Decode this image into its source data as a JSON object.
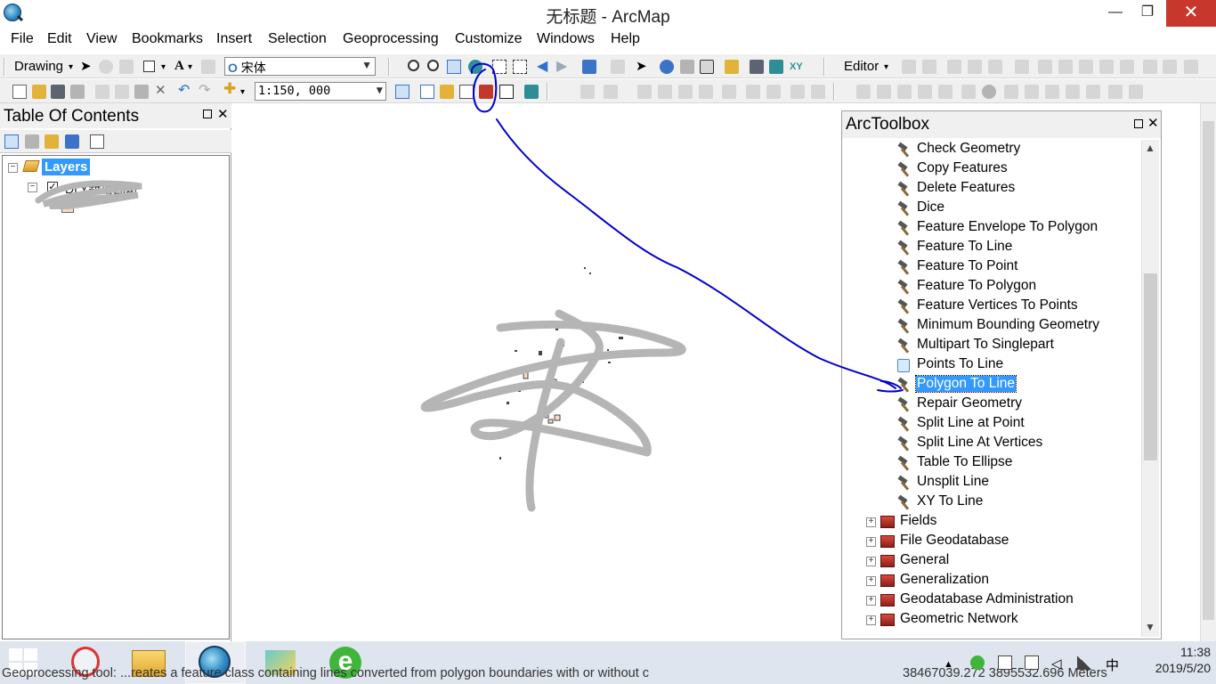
{
  "window": {
    "title": "无标题 - ArcMap",
    "minimize": "—",
    "maximize": "❐",
    "close": "✕"
  },
  "menu": [
    "File",
    "Edit",
    "View",
    "Bookmarks",
    "Insert",
    "Selection",
    "Geoprocessing",
    "Customize",
    "Windows",
    "Help"
  ],
  "toolbar1": {
    "drawing_label": "Drawing",
    "font_name": "宋体",
    "editor_label": "Editor"
  },
  "toolbar2": {
    "scale": "1:150, 000"
  },
  "toc": {
    "title": "Table Of Contents",
    "layers_label": "Layers",
    "layer_name": "DLY新增图斑",
    "checked": true
  },
  "toolbox": {
    "title": "ArcToolbox",
    "tools": [
      {
        "label": "Check Geometry",
        "kind": "hammer"
      },
      {
        "label": "Copy Features",
        "kind": "hammer"
      },
      {
        "label": "Delete Features",
        "kind": "hammer"
      },
      {
        "label": "Dice",
        "kind": "hammer"
      },
      {
        "label": "Feature Envelope To Polygon",
        "kind": "hammer"
      },
      {
        "label": "Feature To Line",
        "kind": "hammer"
      },
      {
        "label": "Feature To Point",
        "kind": "hammer"
      },
      {
        "label": "Feature To Polygon",
        "kind": "hammer"
      },
      {
        "label": "Feature Vertices To Points",
        "kind": "hammer"
      },
      {
        "label": "Minimum Bounding Geometry",
        "kind": "hammer"
      },
      {
        "label": "Multipart To Singlepart",
        "kind": "hammer"
      },
      {
        "label": "Points To Line",
        "kind": "script"
      },
      {
        "label": "Polygon To Line",
        "kind": "hammer",
        "selected": true
      },
      {
        "label": "Repair Geometry",
        "kind": "hammer"
      },
      {
        "label": "Split Line at Point",
        "kind": "hammer"
      },
      {
        "label": "Split Line At Vertices",
        "kind": "hammer"
      },
      {
        "label": "Table To Ellipse",
        "kind": "hammer"
      },
      {
        "label": "Unsplit Line",
        "kind": "hammer"
      },
      {
        "label": "XY To Line",
        "kind": "hammer"
      }
    ],
    "toolsets": [
      "Fields",
      "File Geodatabase",
      "General",
      "Generalization",
      "Geodatabase Administration",
      "Geometric Network"
    ]
  },
  "status": {
    "message": "Geoprocessing tool: ...reates a feature class containing lines converted from polygon boundaries with or without c",
    "coordinates": "38467039.272  3895532.696 Meters"
  },
  "clock": {
    "time": "11:38",
    "date": "2019/5/20"
  },
  "tray": {
    "ime": "中"
  },
  "colors": {
    "selection": "#3399ff",
    "annotation": "#0000cc",
    "scribble": "#b5b5b5"
  }
}
